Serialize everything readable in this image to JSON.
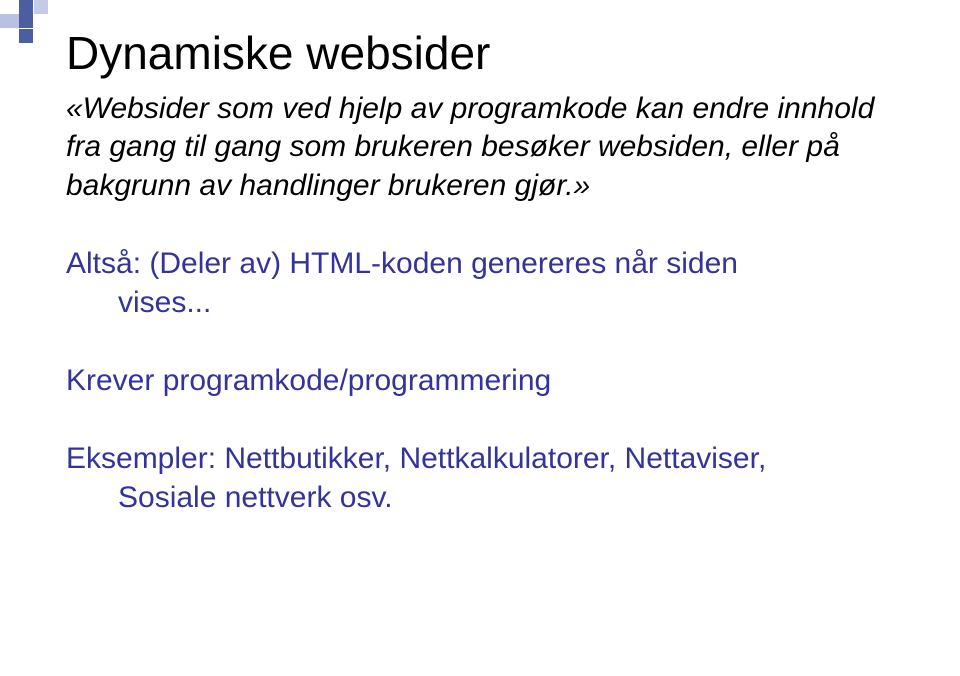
{
  "title": "Dynamiske websider",
  "definition": "«Websider som ved hjelp av programkode kan endre innhold fra gang til gang som brukeren besøker websiden, eller på bakgrunn av handlinger brukeren gjør.»",
  "line1_a": "Altså: (Deler av) HTML-koden genereres når siden",
  "line1_b": "vises...",
  "line2": "Krever programkode/programmering",
  "examples_a": "Eksempler: Nettbutikker, Nettkalkulatorer, Nettaviser,",
  "examples_b": "Sosiale nettverk osv."
}
